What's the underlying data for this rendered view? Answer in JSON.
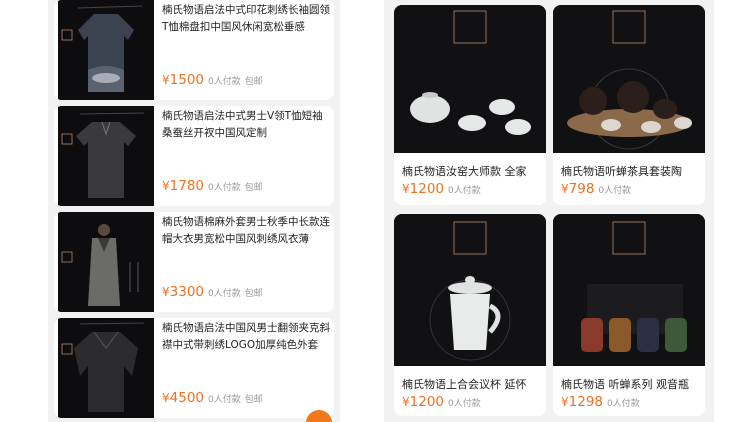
{
  "currency": "¥",
  "colors": {
    "accent": "#f2701d",
    "meta": "#9a9a9a",
    "panel_bg": "#f2f2f2",
    "image_bg": "#0d0d0f"
  },
  "left_list": [
    {
      "title": "楠氏物语启法中式印花刺绣长袖圆领T恤棉盘扣中国风休闲宽松垂感",
      "price": "1500",
      "buyers": "0人付款",
      "shipping": "包邮"
    },
    {
      "title": "楠氏物语启法中式男士V领T恤短袖桑蚕丝开衩中国风定制",
      "price": "1780",
      "buyers": "0人付款",
      "shipping": "包邮"
    },
    {
      "title": "楠氏物语棉麻外套男士秋季中长款连帽大衣男宽松中国风刺绣风衣薄",
      "price": "3300",
      "buyers": "0人付款",
      "shipping": "包邮"
    },
    {
      "title": "楠氏物语启法中国风男士翻领夹克斜襟中式带刺绣LOGO加厚纯色外套",
      "price": "4500",
      "buyers": "0人付款",
      "shipping": "包邮"
    }
  ],
  "right_grid": [
    {
      "title": "楠氏物语汝窑大师款 全家",
      "price": "1200",
      "buyers": "0人付款"
    },
    {
      "title": "楠氏物语听蝉茶具套装陶",
      "price": "798",
      "buyers": "0人付款"
    },
    {
      "title": "楠氏物语上合会议杯 延怀",
      "price": "1200",
      "buyers": "0人付款"
    },
    {
      "title": "楠氏物语 听蝉系列 观音瓶",
      "price": "1298",
      "buyers": "0人付款"
    }
  ],
  "brand_seal": "楠氏物语",
  "icons": {
    "cart": "cart-icon"
  }
}
